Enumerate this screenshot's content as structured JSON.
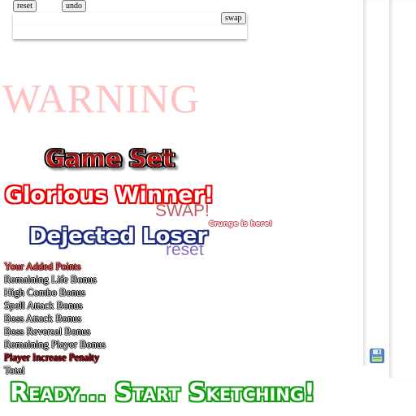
{
  "toolbar": {
    "reset_label": "reset",
    "undo_label": "undo",
    "swap_label": "swap"
  },
  "warning": "WARNING",
  "titles": {
    "game_set": "Game Set",
    "winner": "Glorious Winner!",
    "swap": "SWAP!",
    "crunge": "Crunge is here!",
    "loser": "Dejected Loser",
    "reset": "reset"
  },
  "points": [
    "Your Added Points",
    "Remaining Life Bonus",
    "High Combo Bonus",
    "Spell Attack Bonus",
    "Boss Attack Bonus",
    "Boss Reversal Bonus",
    "Remaining Player Bonus",
    "Player Increase Penalty",
    "Total"
  ],
  "ready": "Ready...  Start Sketching!",
  "icons": {
    "save": "floppy-disk-save-icon"
  },
  "colors": {
    "warning": "#ffc2c2",
    "winner_outline": "#ee0000",
    "loser_outline": "#1a2a80",
    "ready_outline": "#10a010"
  }
}
